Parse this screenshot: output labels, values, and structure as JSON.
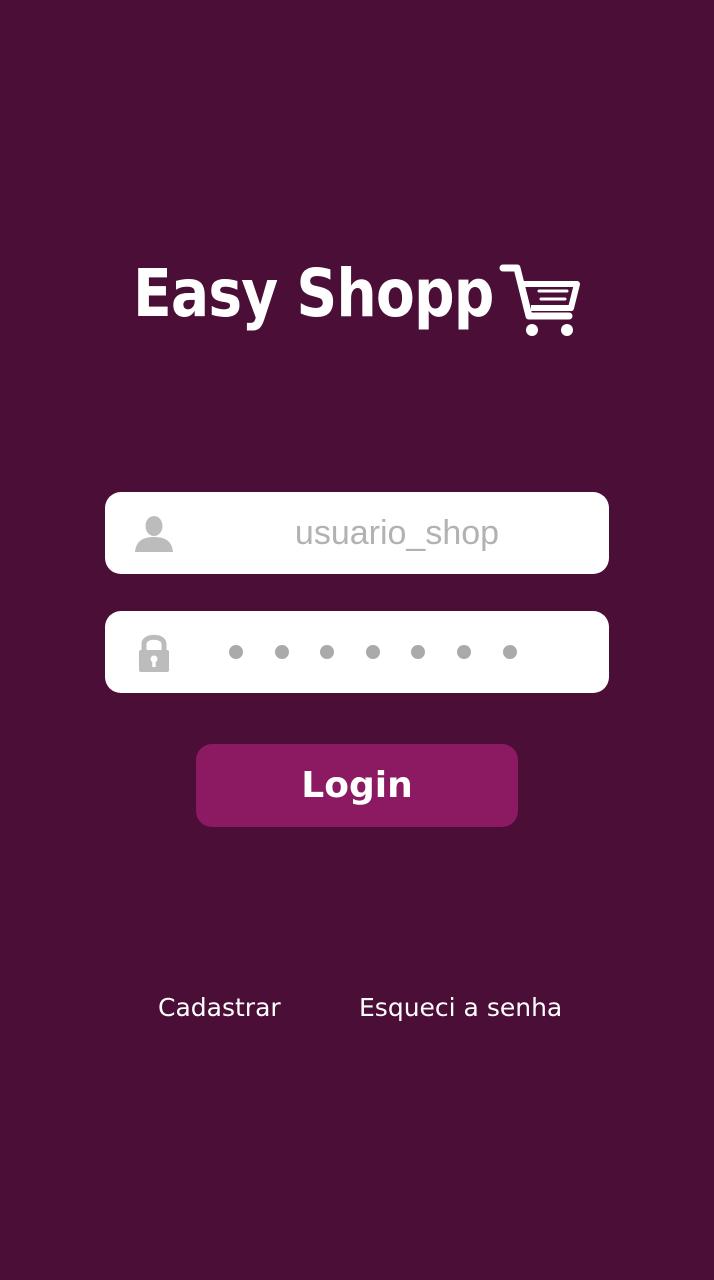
{
  "logo": {
    "text": "Easy Shopp",
    "icon": "shopping-cart-icon"
  },
  "username_field": {
    "icon": "user-icon",
    "value": "usuario_shop"
  },
  "password_field": {
    "icon": "lock-icon",
    "masked_length": 7
  },
  "login_button": {
    "label": "Login"
  },
  "links": {
    "register": "Cadastrar",
    "forgot_password": "Esqueci a senha"
  },
  "colors": {
    "background": "#4a0e37",
    "button": "#8b1a63",
    "field_background": "#ffffff",
    "field_text": "#b2b2b2"
  }
}
